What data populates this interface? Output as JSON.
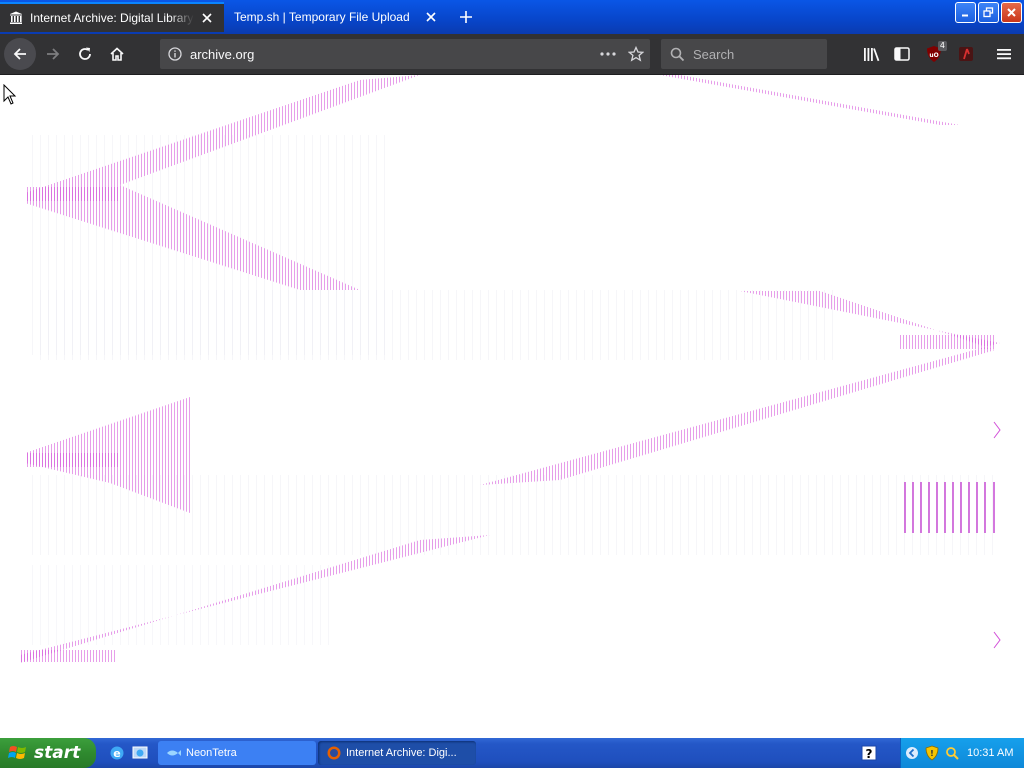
{
  "browser": {
    "tabs": [
      {
        "title": "Internet Archive: Digital Library of Free & Borrowable Books, Movies, Music & Wayback Machine",
        "active": true,
        "icon": "archive-building-icon"
      },
      {
        "title": "Temp.sh | Temporary File Upload",
        "active": false
      }
    ],
    "url": "archive.org",
    "search_placeholder": "Search",
    "ublock_badge": "4"
  },
  "taskbar": {
    "start_label": "start",
    "tasks": [
      {
        "label": "NeonTetra"
      },
      {
        "label": "Internet Archive: Digi..."
      }
    ],
    "clock": "10:31 AM"
  },
  "colors": {
    "tabstrip": "#0845c9",
    "toolbar": "#323234",
    "artifact": "#d24fd8",
    "taskbar": "#2457c7",
    "start": "#2f8a2f"
  }
}
